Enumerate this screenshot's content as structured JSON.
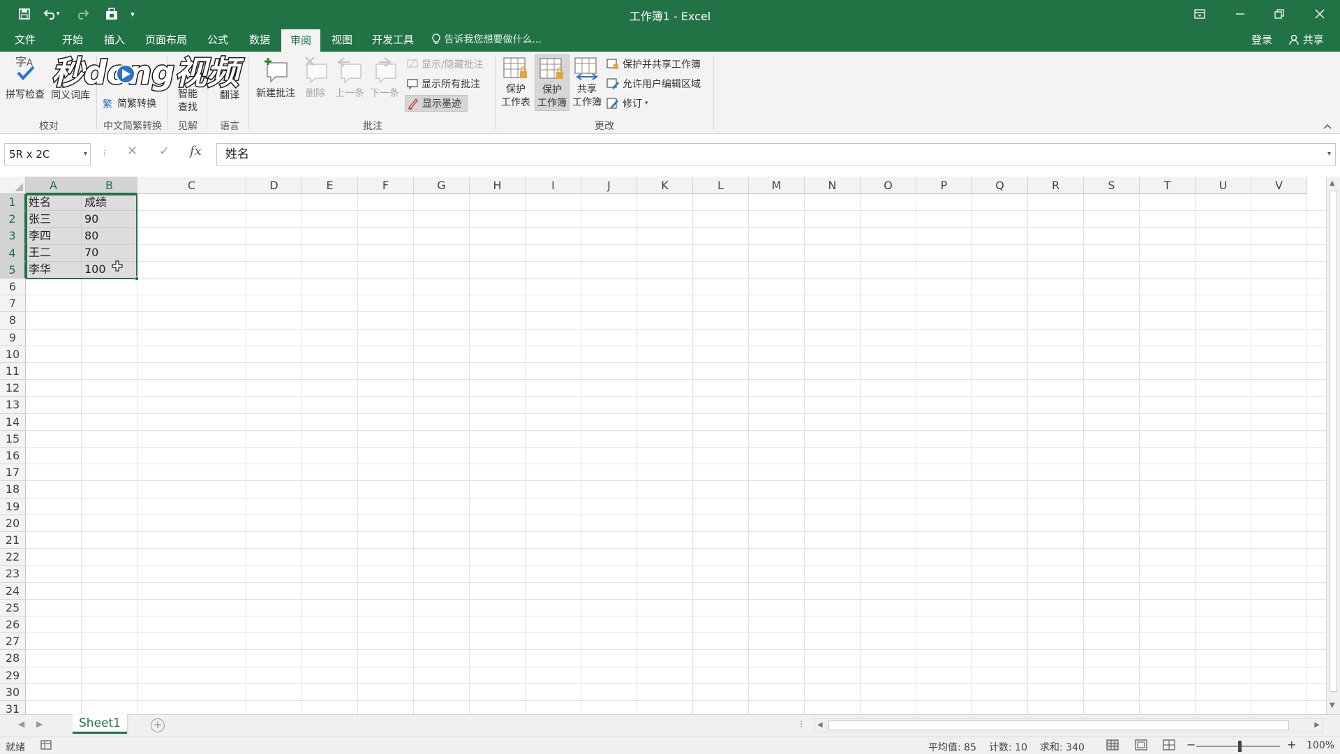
{
  "window": {
    "title": "工作簿1 - Excel",
    "accent": "#217346"
  },
  "quick_access": {
    "icons": [
      "save-icon",
      "undo-icon",
      "redo-icon",
      "qa-extra-icon",
      "customize-qat-icon"
    ]
  },
  "tabs": {
    "file": "文件",
    "home": "开始",
    "insert": "插入",
    "page_layout": "页面布局",
    "formulas": "公式",
    "data": "数据",
    "review": "审阅",
    "view": "视图",
    "developer": "开发工具",
    "tell_me": "告诉我您想要做什么...",
    "login": "登录",
    "share": "共享"
  },
  "ribbon": {
    "proofing": {
      "spell": "拼写检查",
      "thesaurus": "同义词库",
      "label": "校对"
    },
    "chinese": {
      "convert": "简繁转换",
      "label": "中文简繁转换"
    },
    "insights": {
      "smart_lookup_1": "智能",
      "smart_lookup_2": "查找",
      "label": "见解"
    },
    "language": {
      "translate": "翻译",
      "label": "语言"
    },
    "comments": {
      "new": "新建批注",
      "delete": "删除",
      "previous": "上一条",
      "next": "下一条",
      "show_hide": "显示/隐藏批注",
      "show_all": "显示所有批注",
      "show_ink": "显示墨迹",
      "label": "批注"
    },
    "changes": {
      "protect_sheet_1": "保护",
      "protect_sheet_2": "工作表",
      "protect_workbook_1": "保护",
      "protect_workbook_2": "工作簿",
      "share_workbook_1": "共享",
      "share_workbook_2": "工作簿",
      "protect_share": "保护并共享工作簿",
      "allow_edit": "允许用户编辑区域",
      "track_changes": "修订",
      "label": "更改"
    }
  },
  "logo": {
    "text": "秒dong视频"
  },
  "formula_bar": {
    "name_box": "5R x 2C",
    "cancel": "✕",
    "enter": "✓",
    "fx": "fx",
    "value": "姓名"
  },
  "grid": {
    "columns": [
      "A",
      "B",
      "C",
      "D",
      "E",
      "F",
      "G",
      "H",
      "I",
      "J",
      "K",
      "L",
      "M",
      "N",
      "O",
      "P",
      "Q",
      "R",
      "S",
      "T",
      "U",
      "V"
    ],
    "rows": [
      "1",
      "2",
      "3",
      "4",
      "5",
      "6",
      "7",
      "8",
      "9",
      "10",
      "11",
      "12",
      "13",
      "14",
      "15",
      "16",
      "17",
      "18",
      "19",
      "20",
      "21",
      "22",
      "23",
      "24",
      "25",
      "26",
      "27",
      "28",
      "29",
      "30",
      "31"
    ],
    "cells": [
      {
        "a": "姓名",
        "b": "成绩"
      },
      {
        "a": "张三",
        "b": "90"
      },
      {
        "a": "李四",
        "b": "80"
      },
      {
        "a": "王二",
        "b": "70"
      },
      {
        "a": "李华",
        "b": "100"
      }
    ]
  },
  "sheets": {
    "active": "Sheet1"
  },
  "status": {
    "ready": "就绪",
    "average": "平均值: 85",
    "count": "计数: 10",
    "sum": "求和: 340",
    "zoom": "100%"
  }
}
